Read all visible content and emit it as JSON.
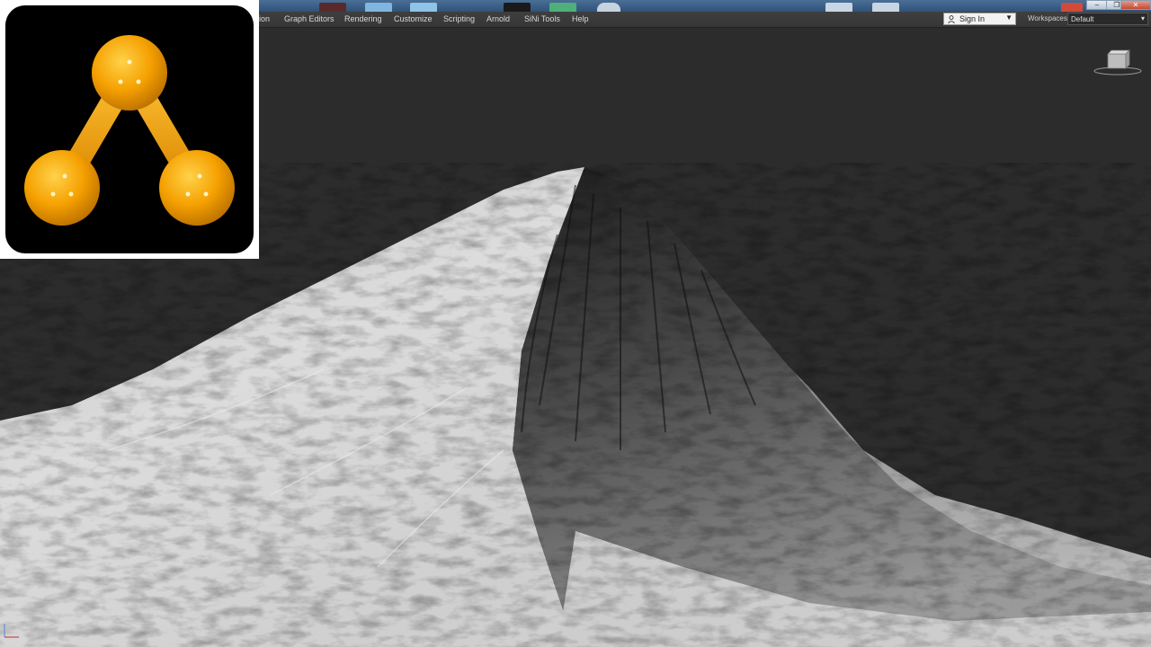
{
  "menu": {
    "items": [
      "ion",
      "Graph Editors",
      "Rendering",
      "Customize",
      "Scripting",
      "Arnold",
      "SiNi Tools",
      "Help"
    ]
  },
  "account": {
    "sign_in_label": "Sign In"
  },
  "workspaces": {
    "label": "Workspaces:",
    "selected": "Default"
  },
  "window_controls": {
    "minimize": "–",
    "restore": "❐",
    "close": "✕"
  },
  "colors": {
    "logo_orange": "#f5a000",
    "menu_bg": "#3a3a3a",
    "viewport_bg": "#2c2c2c",
    "terrain_light": "#d9d9d9",
    "terrain_dark": "#1c1c1c"
  },
  "icons": {
    "logo": "triangle-molecule-icon",
    "user": "user-icon",
    "viewcube": "viewcube-icon",
    "axis": "axis-tripod-icon"
  }
}
